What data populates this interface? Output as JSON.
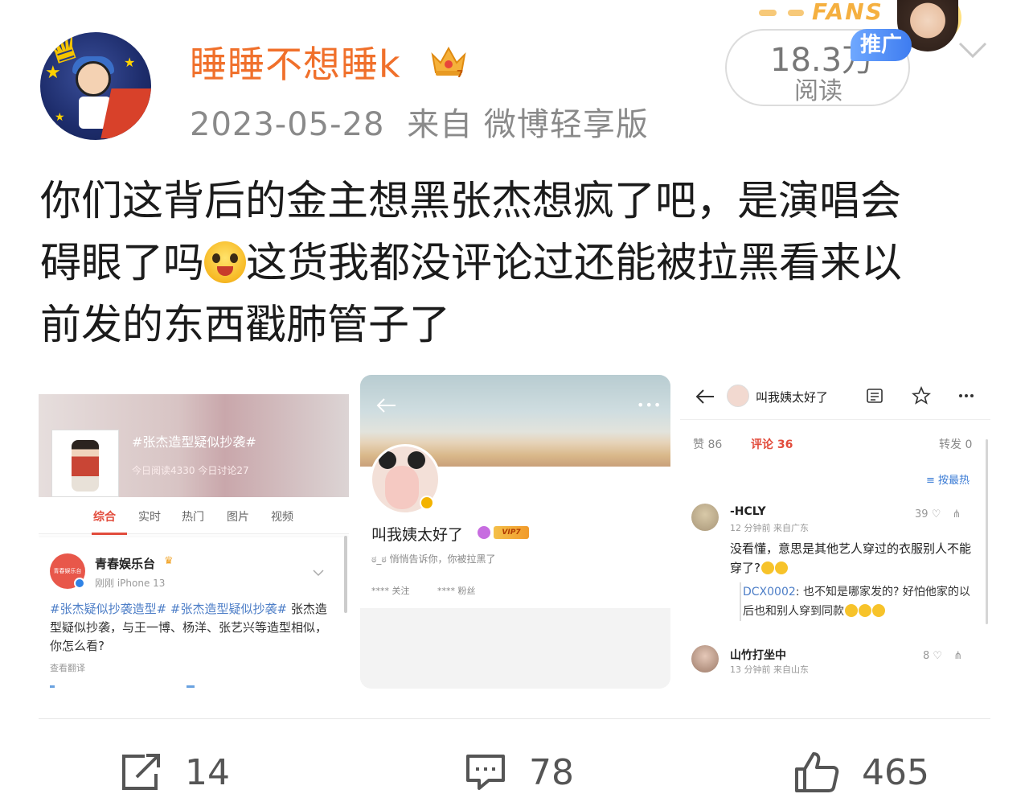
{
  "post": {
    "username": "睡睡不想睡k",
    "date": "2023-05-28",
    "source": "来自 微博轻享版",
    "read_count": "18.3万",
    "read_label": "阅读",
    "promo_label": "推广",
    "fans_label": "FANS",
    "text_line1": "你们这背后的金主想黑张杰想疯了吧，是演唱会",
    "text_line2a": "碍眼了吗",
    "text_line2b": "这货我都没评论过还能被拉黑看来以",
    "text_line3": "前发的东西戳肺管子了"
  },
  "image1": {
    "topic_title": "#张杰造型疑似抄袭#",
    "topic_stats": "今日阅读4330  今日讨论27",
    "tabs": [
      "综合",
      "实时",
      "热门",
      "图片",
      "视频"
    ],
    "account_logo_text": "青春娱乐台",
    "account_name": "青春娱乐台",
    "account_meta": "刚刚   iPhone 13",
    "tag1": "#张杰疑似抄袭造型#",
    "tag2": "#张杰造型疑似抄袭#",
    "body_rest": "张杰造型疑似抄袭，与王一博、杨洋、张艺兴等造型相似，你怎么看?",
    "translate": "查看翻译"
  },
  "image2": {
    "name": "叫我姨太好了",
    "vip_badge": "VIP7",
    "message": "ಠ_ಠ 悄悄告诉你，你被拉黑了",
    "follow": "**** 关注",
    "fans": "**** 粉丝",
    "more": "•••"
  },
  "image3": {
    "title": "叫我姨太好了",
    "likes_label": "赞  86",
    "comments_label": "评论  36",
    "reposts_label": "转发  0",
    "sort_label": "按最热",
    "comment1": {
      "name": "-HCLY",
      "time": "12 分钟前  来自广东",
      "likes": "39",
      "text": "没看懂，意思是其他艺人穿过的衣服别人不能穿了?"
    },
    "reply": {
      "name": "DCX0002",
      "text": ": 也不知是哪家发的? 好怕他家的以后也和别人穿到同款"
    },
    "comment2": {
      "name": "山竹打坐中",
      "time": "13 分钟前  来自山东",
      "likes": "8"
    }
  },
  "footer": {
    "repost_count": "14",
    "comment_count": "78",
    "like_count": "465"
  },
  "colors": {
    "username": "#f0702b",
    "meta_gray": "#8a8a8a",
    "link_blue": "#4d7ec7",
    "accent_red": "#e24c3c",
    "promo_blue": "#3e7cf0"
  }
}
